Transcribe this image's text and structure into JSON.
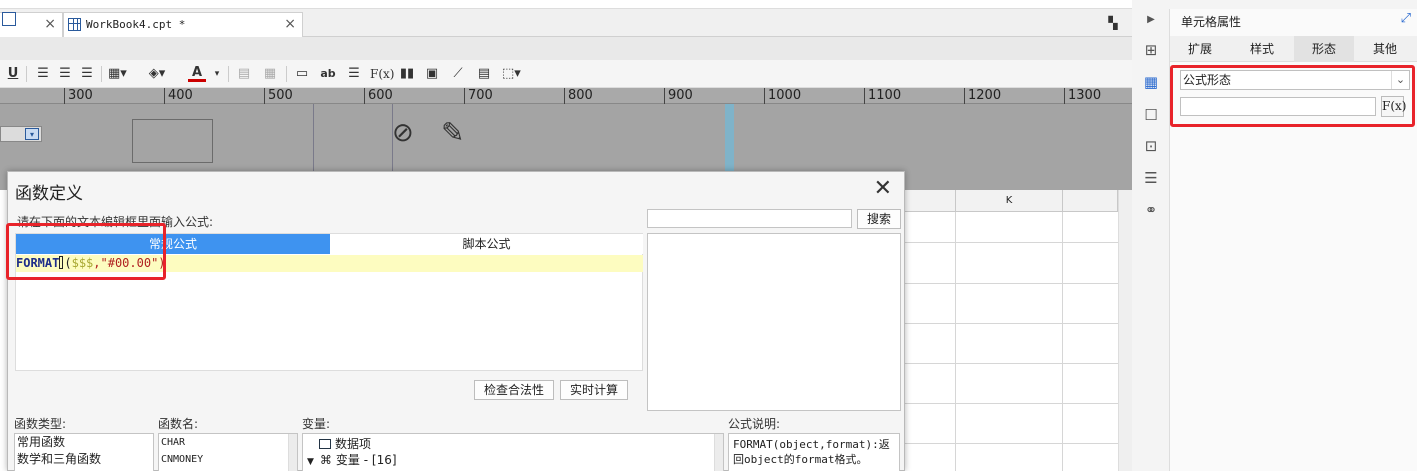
{
  "tabs": [
    {
      "label": "WorkBook4.cpt *",
      "close": "×"
    }
  ],
  "prev_tab_close": "×",
  "ruler_ticks": [
    "300",
    "400",
    "500",
    "600",
    "700",
    "800",
    "900",
    "1000",
    "1100",
    "1200",
    "1300"
  ],
  "grid": {
    "column_k": "K"
  },
  "cell_attributes": {
    "title": "单元格属性",
    "tabs": [
      "扩展",
      "样式",
      "形态",
      "其他"
    ],
    "active_tab": "形态",
    "form_type_value": "公式形态",
    "fx_label": "F(x)"
  },
  "dialog": {
    "title": "函数定义",
    "close": "✕",
    "hint": "请在下面的文本编辑框里面输入公式:",
    "editor_tabs": {
      "regular": "常规公式",
      "script": "脚本公式"
    },
    "formula": {
      "fn": "FORMAT",
      "open": "(",
      "var": "$$$",
      "rest": ",\"#00.00\")"
    },
    "search_button": "搜索",
    "check_button": "检查合法性",
    "realtime_button": "实时计算",
    "labels": {
      "function_type": "函数类型:",
      "function_name": "函数名:",
      "variables": "变量:",
      "description": "公式说明:"
    },
    "function_types": [
      "常用函数",
      "数学和三角函数"
    ],
    "function_names": [
      "CHAR",
      "CNMONEY"
    ],
    "variables_tree": [
      {
        "label": "数据项",
        "icon": "table-icon"
      },
      {
        "label": "变量 - [16]",
        "icon": "variable-icon"
      }
    ],
    "description_text": [
      "FORMAT(object,format):返",
      "回object的format格式。"
    ]
  },
  "colors": {
    "accent_blue": "#3e93f0",
    "highlight_red": "#e8232a",
    "code_bg": "#fdfcc0"
  }
}
